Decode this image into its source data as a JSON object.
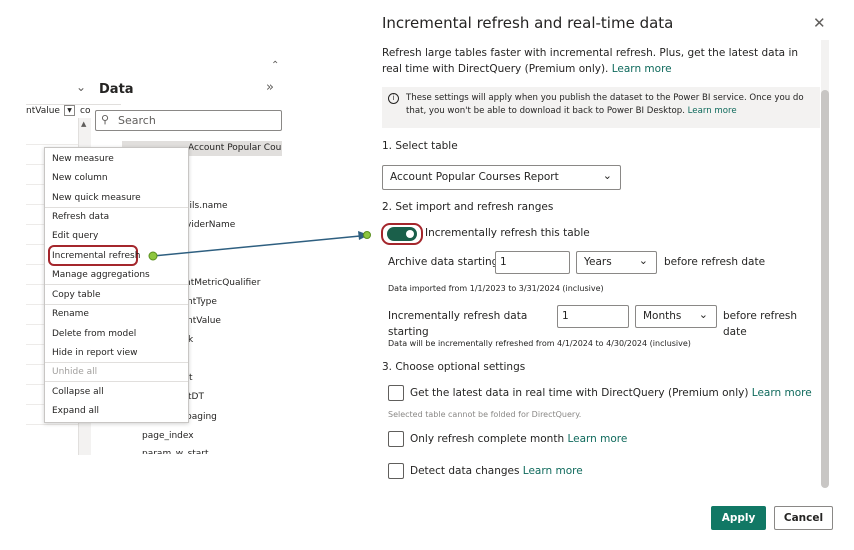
{
  "left_panel": {
    "column_header_fragment": "ntValue",
    "column_header_fragment2": "co",
    "data_title": "Data",
    "search_placeholder": "Search",
    "table_name": "Account Popular Courses Report",
    "tree_fields": [
      "ails.name",
      "viderName",
      "ntMetricQualifier",
      "ntType",
      "ntValue",
      "k",
      "t",
      "tDT",
      "paging",
      "page_index",
      "param_w_start"
    ],
    "context_menu": [
      {
        "label": "New measure",
        "disabled": false
      },
      {
        "label": "New column",
        "disabled": false
      },
      {
        "label": "New quick measure",
        "disabled": false
      },
      {
        "label": "Refresh data",
        "disabled": false
      },
      {
        "label": "Edit query",
        "disabled": false
      },
      {
        "label": "Incremental refresh",
        "disabled": false,
        "highlighted": true
      },
      {
        "label": "Manage aggregations",
        "disabled": false
      },
      {
        "label": "Copy table",
        "disabled": false
      },
      {
        "label": "Rename",
        "disabled": false
      },
      {
        "label": "Delete from model",
        "disabled": false
      },
      {
        "label": "Hide in report view",
        "disabled": false
      },
      {
        "label": "Unhide all",
        "disabled": true
      },
      {
        "label": "Collapse all",
        "disabled": false
      },
      {
        "label": "Expand all",
        "disabled": false
      }
    ]
  },
  "dialog": {
    "title": "Incremental refresh and real-time data",
    "intro_text": "Refresh large tables faster with incremental refresh. Plus, get the latest data in real time with DirectQuery (Premium only).",
    "intro_link": "Learn more",
    "info_text": "These settings will apply when you publish the dataset to the Power BI service. Once you do that, you won't be able to download it back to Power BI Desktop.",
    "info_link": "Learn more",
    "section1": "1. Select table",
    "selected_table": "Account Popular Courses Report",
    "section2": "2. Set import and refresh ranges",
    "toggle_label": "Incrementally refresh this table",
    "toggle_on": true,
    "archive_label": "Archive data starting",
    "archive_value": "1",
    "archive_unit": "Years",
    "archive_suffix": "before refresh date",
    "imported_note": "Data imported from 1/1/2023 to 3/31/2024 (inclusive)",
    "incr_label_line1": "Incrementally refresh data",
    "incr_label_line2": "starting",
    "incr_value": "1",
    "incr_unit": "Months",
    "incr_suffix_line1": "before refresh",
    "incr_suffix_line2": "date",
    "incr_note": "Data will be incrementally refreshed from 4/1/2024 to 4/30/2024 (inclusive)",
    "section3": "3. Choose optional settings",
    "opt_realtime_label": "Get the latest data in real time with DirectQuery (Premium only)",
    "opt_realtime_link": "Learn more",
    "opt_realtime_note": "Selected table cannot be folded for DirectQuery.",
    "opt_complete_label": "Only refresh complete month",
    "opt_complete_link": "Learn more",
    "opt_detect_label": "Detect data changes",
    "opt_detect_link": "Learn more",
    "apply_label": "Apply",
    "cancel_label": "Cancel"
  },
  "colors": {
    "accent": "#117865",
    "link": "#0f6a5c",
    "highlight": "#a4262c",
    "arrow": "#2e5f80",
    "arrow_dot": "#8dc63f"
  }
}
